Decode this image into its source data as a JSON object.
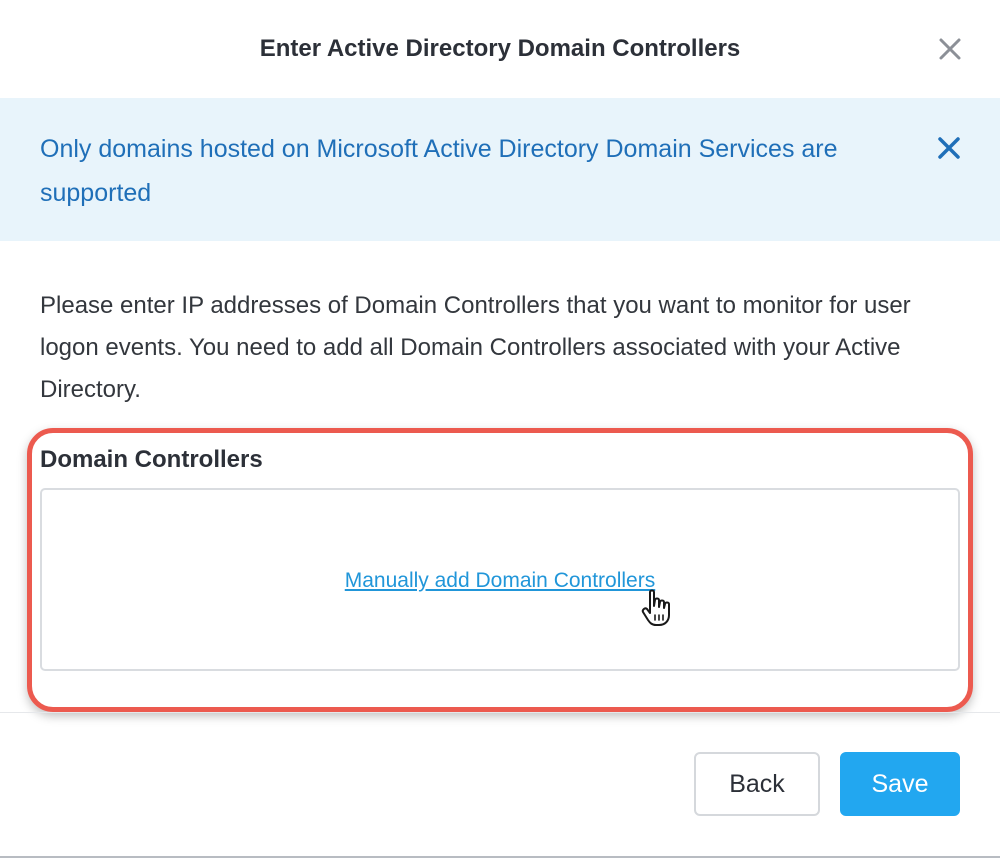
{
  "dialog": {
    "title": "Enter Active Directory Domain Controllers",
    "close_icon": "close-icon"
  },
  "banner": {
    "message": "Only domains hosted on Microsoft Active Directory Domain Services are supported",
    "close_icon": "close-icon",
    "text_color": "#1f6fb8",
    "background": "#e8f4fb"
  },
  "description": "Please enter IP addresses of Domain Controllers that you want to monitor for user logon events. You need to add all Domain Controllers associated with your Active Directory.",
  "domain_controllers": {
    "label": "Domain Controllers",
    "add_link": "Manually add Domain Controllers",
    "highlight_color": "#ec5a4f"
  },
  "footer": {
    "back_label": "Back",
    "save_label": "Save",
    "accent": "#22a7f0"
  }
}
